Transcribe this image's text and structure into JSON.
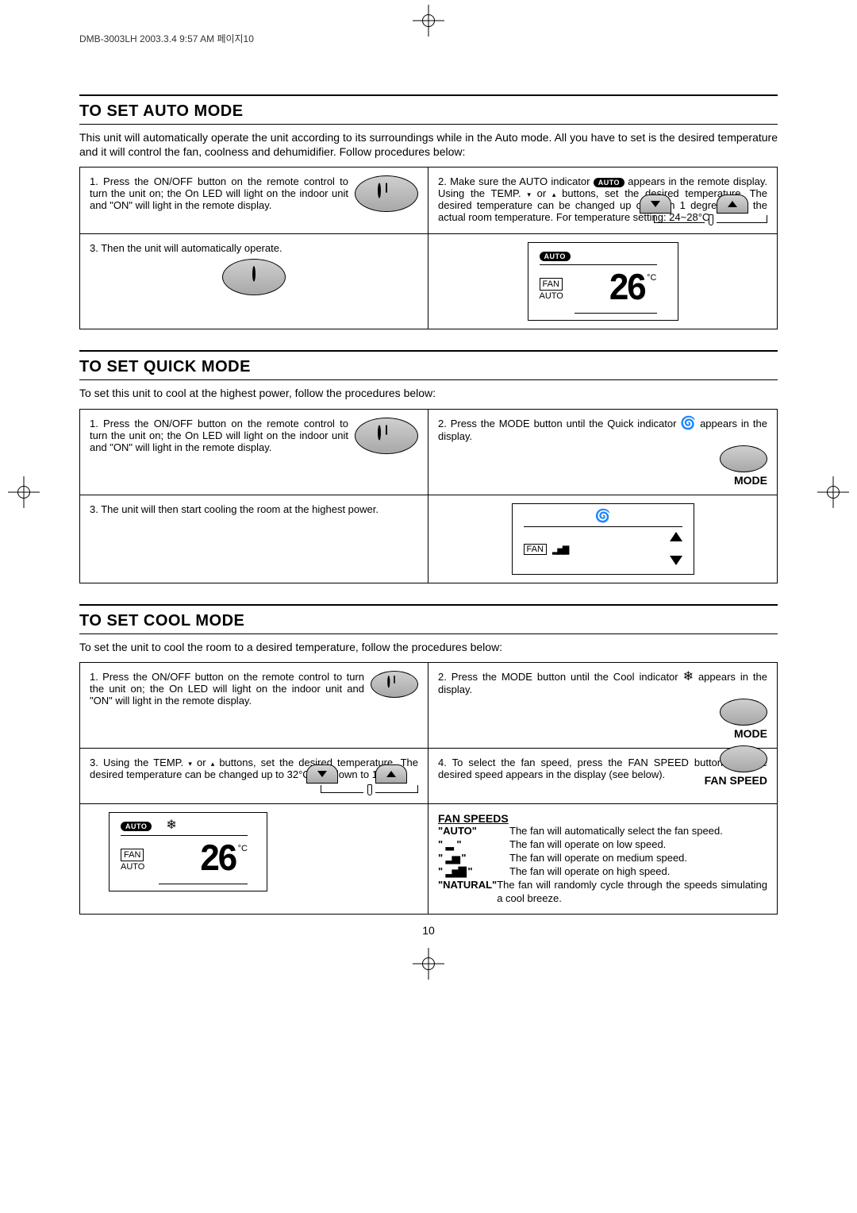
{
  "print_header": "DMB-3003LH  2003.3.4 9:57 AM  페이지10",
  "page_number": "10",
  "auto_pill": "AUTO",
  "fan_box": "FAN",
  "auto_label": "AUTO",
  "deg_c": "°C",
  "temp_display": "26",
  "mode_label": "MODE",
  "fanspeed_label": "FAN SPEED",
  "small_down": "▾",
  "small_up": "▴",
  "sections": {
    "auto": {
      "title": "TO SET AUTO MODE",
      "intro": "This unit will automatically operate the unit according to its surroundings while in the Auto mode. All you have to set is the desired temperature and it will control the fan, coolness and dehumidifier. Follow procedures below:",
      "step1": "1. Press the ON/OFF button on the remote control to turn the unit on; the On LED will light on the indoor unit and \"ON\" will light in the remote display.",
      "step2a": "2. Make sure the AUTO indicator ",
      "step2b": " appears in the remote display. Using the TEMP. ",
      "step2c": " or ",
      "step2d": " buttons, set the desired temperature. The desired temperature can be changed up or down 1 degree from the actual room temperature. For temperature setting: 24~28°C",
      "step3": "3. Then the unit will automatically operate."
    },
    "quick": {
      "title": "TO SET QUICK MODE",
      "intro": "To set this unit to cool at the highest power, follow the procedures below:",
      "step1": "1. Press the ON/OFF button on the remote control to turn the unit on; the On LED will light on the indoor unit and \"ON\" will light in the remote display.",
      "step2a": "2. Press the MODE button until the Quick indicator ",
      "step2b": " appears in the display.",
      "step3": "3. The unit will then start cooling the room at the highest power."
    },
    "cool": {
      "title": "TO SET COOL MODE",
      "intro": "To set the unit to cool the room to a desired temperature, follow the procedures below:",
      "step1": "1. Press the ON/OFF button on the remote control to turn the unit on; the On LED will light on the indoor unit and \"ON\" will light in the remote display.",
      "step2a": "2. Press the MODE button until the Cool indicator ",
      "step2b": " appears in the display.",
      "step3a": "3. Using the TEMP. ",
      "step3b": " or ",
      "step3c": " buttons, set the desired temperature. The desired temperature can be changed up to 32°C and down to 18°C.",
      "step4": "4. To select the fan speed, press the FAN SPEED button until the desired speed appears in the display (see below)."
    }
  },
  "fanspeeds": {
    "title": "FAN SPEEDS",
    "rows": [
      {
        "label": "\"AUTO\"",
        "desc": "The fan will automatically select the fan speed."
      },
      {
        "label": "low",
        "desc": "The fan will operate on low speed."
      },
      {
        "label": "med",
        "desc": "The fan will operate on medium speed."
      },
      {
        "label": "high",
        "desc": "The fan will operate on high speed."
      },
      {
        "label": "\"NATURAL\"",
        "desc": "The fan will randomly cycle through the speeds simulating a cool breeze."
      }
    ]
  }
}
